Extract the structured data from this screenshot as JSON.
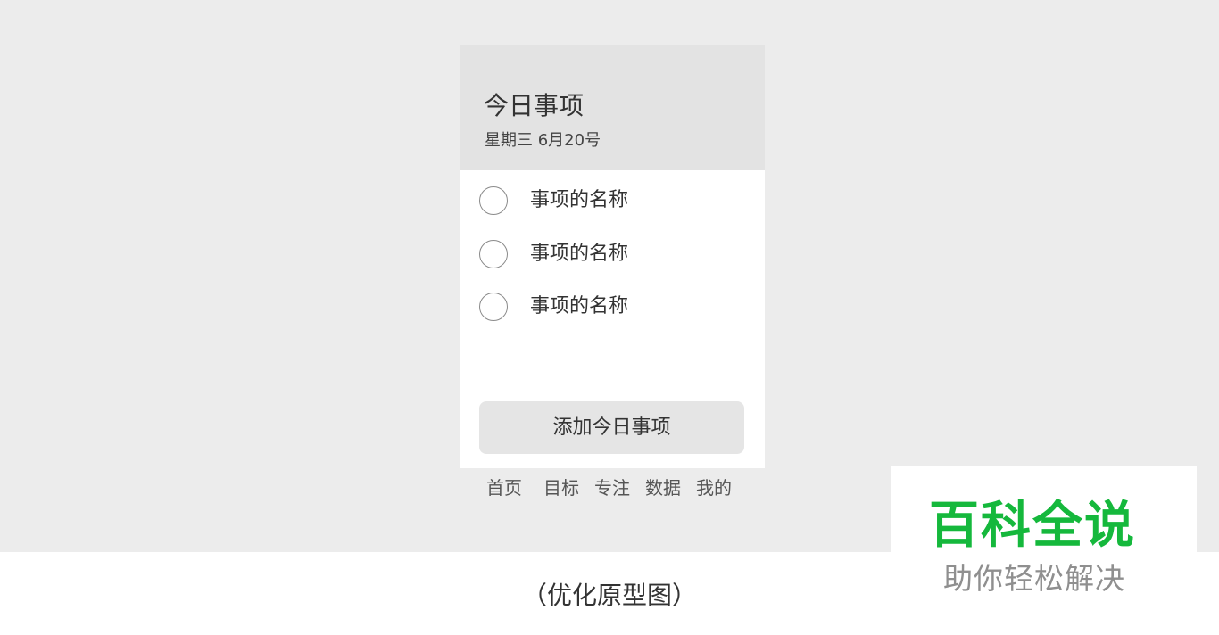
{
  "header": {
    "title": "今日事项",
    "date": "星期三 6月20号"
  },
  "todos": [
    {
      "label": "事项的名称",
      "checked": false
    },
    {
      "label": "事项的名称",
      "checked": false
    },
    {
      "label": "事项的名称",
      "checked": false
    }
  ],
  "add_button": {
    "label": "添加今日事项"
  },
  "tabbar": {
    "items": [
      {
        "label": "首页"
      },
      {
        "label": "目标"
      },
      {
        "label": "专注"
      },
      {
        "label": "数据"
      },
      {
        "label": "我的"
      }
    ]
  },
  "caption": "（优化原型图）",
  "watermark": {
    "title": "百科全说",
    "subtitle": "助你轻松解决"
  },
  "colors": {
    "watermark_green": "#15b83c",
    "header_bg": "#e3e3e3",
    "canvas_bg": "#ececec"
  }
}
